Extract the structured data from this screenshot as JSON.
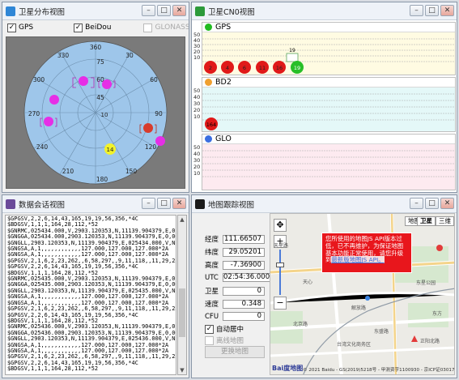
{
  "sky": {
    "title": "卫星分布视图",
    "cb_gps": "GPS",
    "cb_beidou": "BeiDou",
    "cb_glonass": "GLONASS",
    "labels_outer": [
      "360",
      "30",
      "60",
      "270",
      "90",
      "240",
      "120",
      "210",
      "180",
      "150",
      "330",
      "300"
    ],
    "labels_inner": [
      "75",
      "60",
      "45"
    ],
    "sats": [
      "10",
      "14"
    ]
  },
  "cn0": {
    "title": "卫星CN0视图",
    "gps": {
      "name": "GPS",
      "color": "#22bb22",
      "sats": [
        "2",
        "4",
        "6",
        "11",
        "16",
        "19"
      ],
      "bar_label": "19",
      "bar_level": 0.3
    },
    "bd2": {
      "name": "BD2",
      "color": "#f0a030",
      "sats": [
        "164"
      ]
    },
    "glo": {
      "name": "GLO",
      "color": "#3a6ee0",
      "sats": []
    },
    "axis_ticks": [
      "50",
      "40",
      "30",
      "20",
      "10"
    ]
  },
  "log": {
    "title": "数据会话视图",
    "text": "$GPGSV,2,2,6,14,43,165,19,19,56,356,*4C\n$BDGSV,1,1,1,164,28,112,*52\n$GNRMC,025434.000,V,2903.120353,N,11139.904379,E,0.0\n$GNGGA,025434.000,2903.120353,N,11139.904379,E,0,00\n$GNGLL,2903.120353,N,11139.904379,E,025434.000,V,N*\n$GNGSA,A,1,,,,,,,,,,,,127.000,127.000,127.000*2A\n$GNGSA,A,1,,,,,,,,,,,,127.000,127.000,127.000*2A\n$GPGSV,2,1,6,2,23,262,,6,58,297,,9,11,118,,11,29,25\n$GPGSV,2,2,6,14,43,165,19,19,56,356,*4C\n$BDGSV,1,1,1,164,28,112,*52\n$GNRMC,025435.000,V,2903.120353,N,11139.904379,E,0.0\n$GNGGA,025435.000,2903.120353,N,11139.904379,E,0,00\n$GNGLL,2903.120353,N,11139.904379,E,025435.000,V,N*\n$GNGSA,A,1,,,,,,,,,,,,127.000,127.000,127.000*2A\n$GNGSA,A,1,,,,,,,,,,,,127.000,127.000,127.000*2A\n$GPGSV,2,1,6,2,23,262,,6,58,297,,9,11,118,,11,29,25\n$GPGSV,2,2,6,14,43,165,19,19,56,356,*4C\n$BDGSV,1,1,1,164,28,112,*52\n$GNRMC,025436.000,V,2903.120353,N,11139.904379,E,0.0\n$GNGGA,025436.000,2903.120353,N,11139.904379,E,0,00\n$GNGLL,2903.120353,N,11139.904379,E,025436.000,V,N*\n$GNGSA,A,1,,,,,,,,,,,,127.000,127.000,127.000*2A\n$GNGSA,A,1,,,,,,,,,,,,127.000,127.000,127.000*2A\n$GPGSV,2,1,6,2,23,262,,6,58,297,,9,11,118,,11,29,25\n$GPGSV,2,2,6,14,43,165,19,19,56,356,*4C\n$BDGSV,1,1,1,164,28,112,*52"
  },
  "map": {
    "title": "地图跟踪视图",
    "fields": [
      {
        "label": "经度",
        "value": "111.66507"
      },
      {
        "label": "纬度",
        "value": "29.05201"
      },
      {
        "label": "高度",
        "value": "-7.36900"
      },
      {
        "label": "UTC",
        "value": "02:54:36.000"
      },
      {
        "label": "卫星",
        "value": "0"
      },
      {
        "label": "速度",
        "value": "0.348"
      },
      {
        "label": "CFU",
        "value": "0"
      }
    ],
    "auto_center": "自动居中",
    "offline_map": "离线地图",
    "change_map": "更换地图",
    "warning": "您所使用的地图JS API版本过低，已不再维护，为保证地图基本功能正常使用，请您升级到",
    "warning_link": "最新版地图JS API。",
    "chip_map": "地图",
    "chip_sat": "卫星",
    "chip_3d": "三维",
    "baidu_logo": "Bai度地图",
    "copyright": "© 2021 Baidu - GS(2019)5218号 - 甲测资字1100930 - 京ICP证030173号",
    "places": [
      "天星路",
      "天心",
      "北京路",
      "台湾文化商务区",
      "东星公园",
      "解放路",
      "东盛路",
      "正阳北路",
      "东方"
    ]
  }
}
